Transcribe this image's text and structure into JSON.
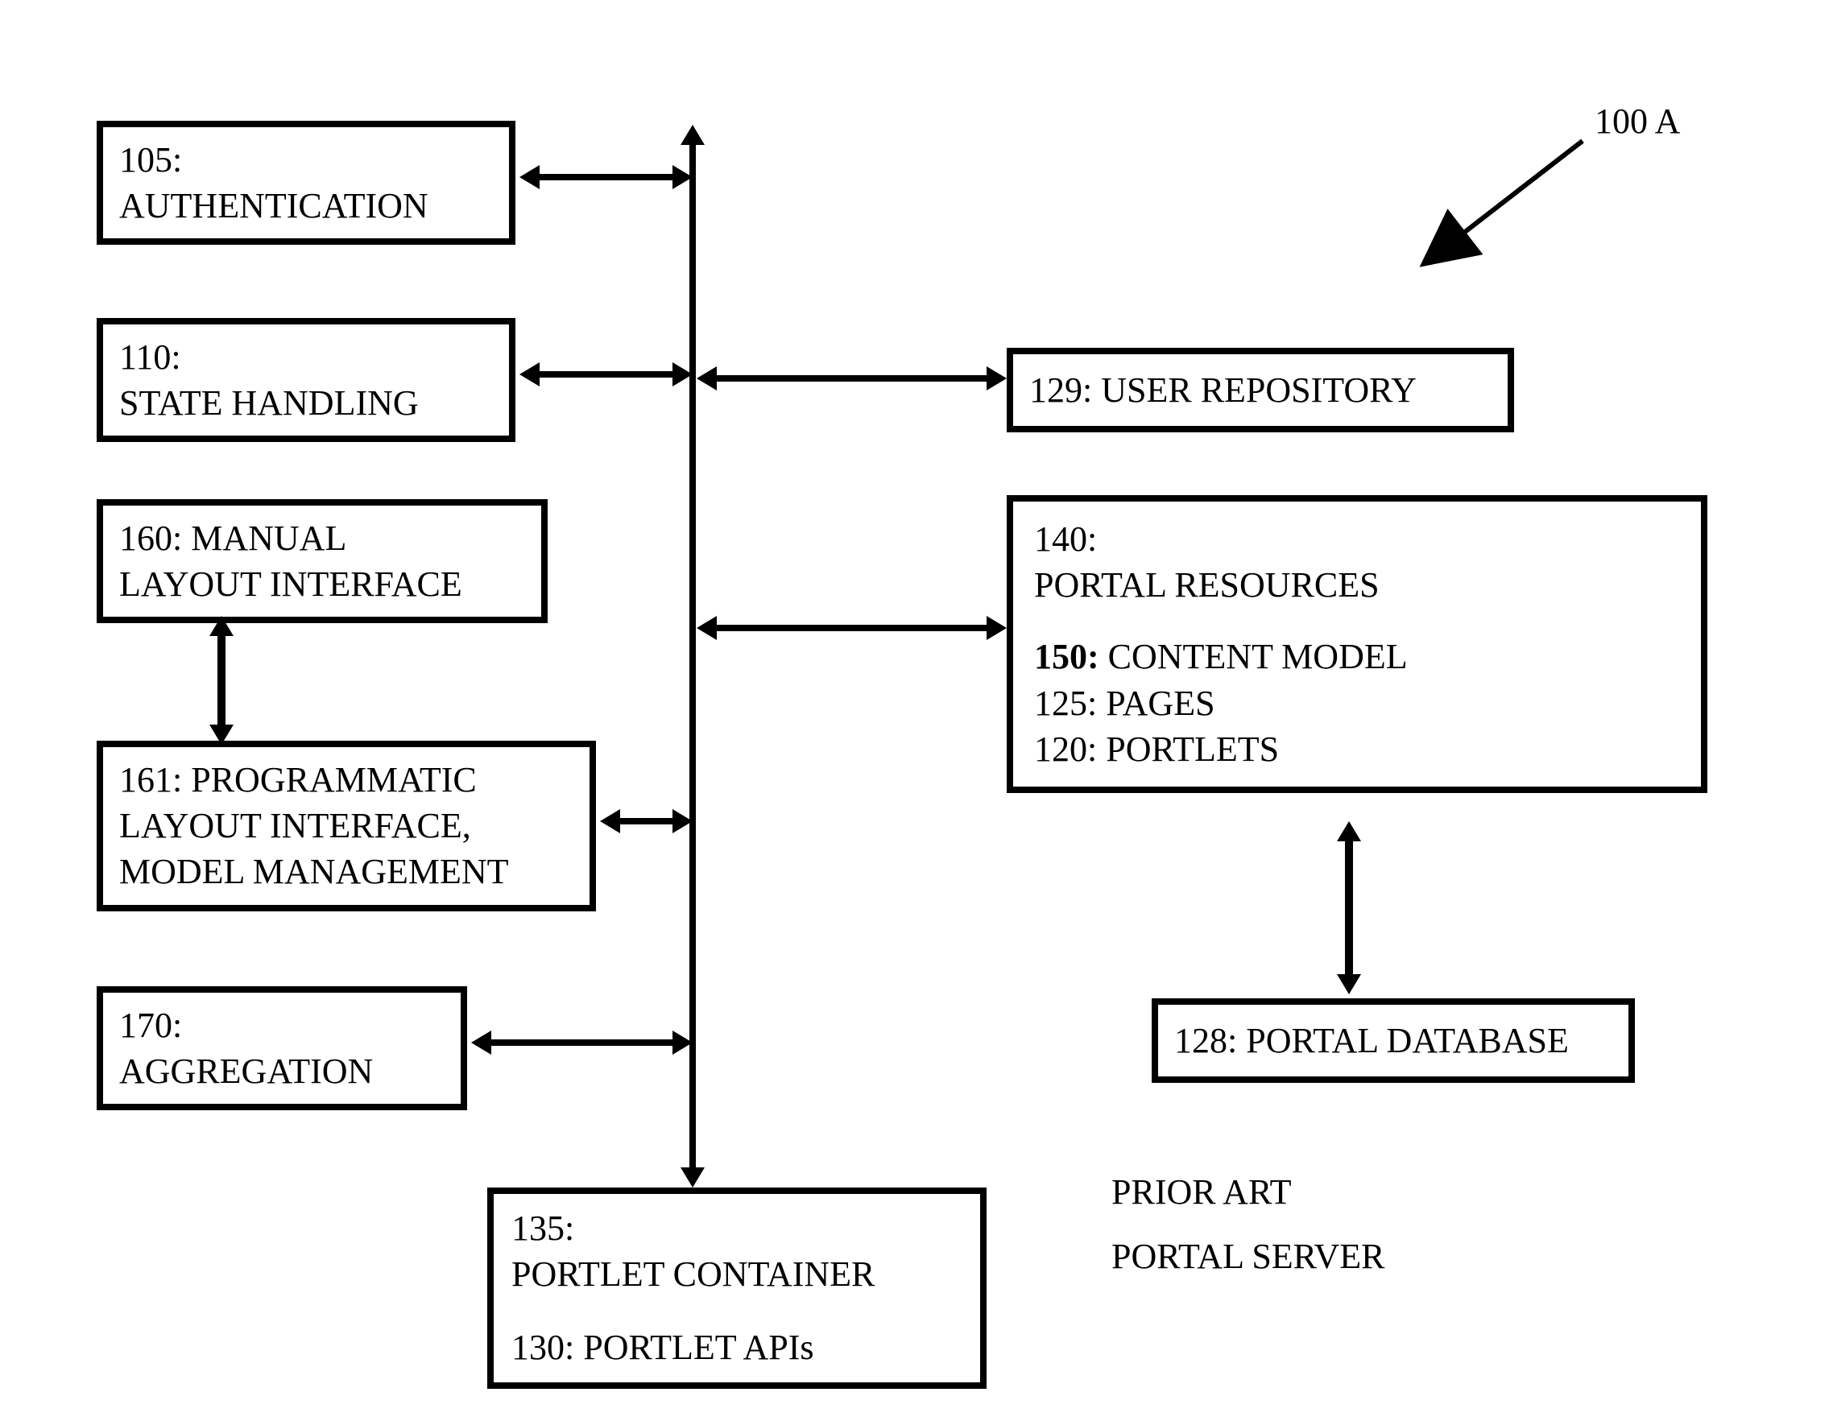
{
  "figure_id": "100 A",
  "prior_art_line1": "PRIOR ART",
  "prior_art_line2": "PORTAL SERVER",
  "boxes": {
    "b105": {
      "num": "105:",
      "text": "AUTHENTICATION"
    },
    "b110": {
      "num": "110:",
      "text": "STATE HANDLING"
    },
    "b160": {
      "num": "160:  MANUAL",
      "text": "LAYOUT INTERFACE"
    },
    "b161": {
      "num": "161:  PROGRAMMATIC",
      "text1": "LAYOUT INTERFACE,",
      "text2": "MODEL MANAGEMENT"
    },
    "b170": {
      "num": "170:",
      "text": "AGGREGATION"
    },
    "b129": {
      "text": "129: USER REPOSITORY"
    },
    "b140": {
      "num": "140:",
      "title": "PORTAL RESOURCES",
      "l1num": "150:",
      "l1txt": " CONTENT MODEL",
      "l2": "125:  PAGES",
      "l3": "120:  PORTLETS"
    },
    "b128": {
      "text": "128: PORTAL DATABASE"
    },
    "b135": {
      "num": "135:",
      "text1": "PORTLET CONTAINER",
      "text2": "130:  PORTLET APIs"
    }
  }
}
